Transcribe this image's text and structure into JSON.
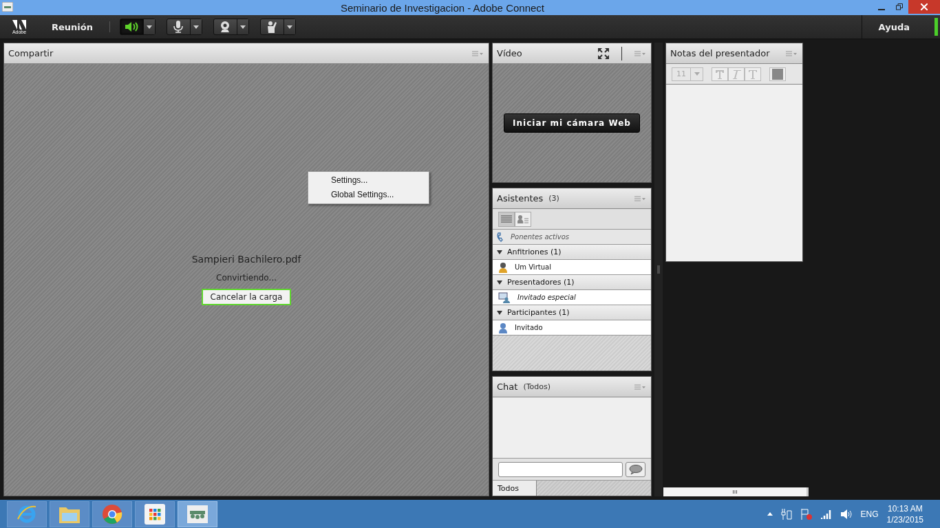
{
  "window": {
    "title": "Seminario de Investigacion - Adobe Connect"
  },
  "menu_bar": {
    "logo_text": "Adobe",
    "meeting_menu": "Reunión",
    "help": "Ayuda",
    "tools": [
      {
        "kind": "speaker",
        "on": true
      },
      {
        "kind": "mic",
        "on": false
      },
      {
        "kind": "webcam",
        "on": false
      },
      {
        "kind": "hand",
        "on": false
      }
    ]
  },
  "share_pod": {
    "title": "Compartir",
    "file_name": "Sampieri Bachilero.pdf",
    "status": "Convirtiendo...",
    "cancel_button": "Cancelar la carga",
    "context_menu": [
      "Settings...",
      "Global Settings..."
    ]
  },
  "video_pod": {
    "title": "Vídeo",
    "start_button": "Iniciar mi cámara Web"
  },
  "attendees_pod": {
    "title": "Asistentes",
    "count": "(3)",
    "view_tabs": [
      {
        "kind": "list",
        "selected": true
      },
      {
        "kind": "cards",
        "selected": false
      }
    ],
    "active_speakers": "Ponentes activos",
    "groups": [
      {
        "label": "Anfitriones (1)",
        "expanded": true,
        "children": [
          {
            "name": "Um Virtual",
            "kind": "host",
            "current_user": false
          }
        ]
      },
      {
        "label": "Presentadores (1)",
        "expanded": true,
        "children": [
          {
            "name": "Invitado especial",
            "kind": "presenter",
            "current_user": true
          }
        ]
      },
      {
        "label": "Participantes (1)",
        "expanded": true,
        "children": [
          {
            "name": "Invitado",
            "kind": "participant",
            "current_user": false
          }
        ]
      }
    ]
  },
  "chat_pod": {
    "title": "Chat",
    "audience": "(Todos)",
    "recipient_tab": "Todos"
  },
  "notes_pod": {
    "title": "Notas del presentador",
    "font_size": "11"
  },
  "taskbar": {
    "apps": [
      {
        "kind": "ie",
        "selected": false
      },
      {
        "kind": "folder",
        "selected": false
      },
      {
        "kind": "chrome",
        "selected": false
      },
      {
        "kind": "apps",
        "selected": false
      },
      {
        "kind": "connect",
        "selected": true
      }
    ],
    "language": "ENG",
    "time": "10:13 AM",
    "date": "1/23/2015"
  }
}
